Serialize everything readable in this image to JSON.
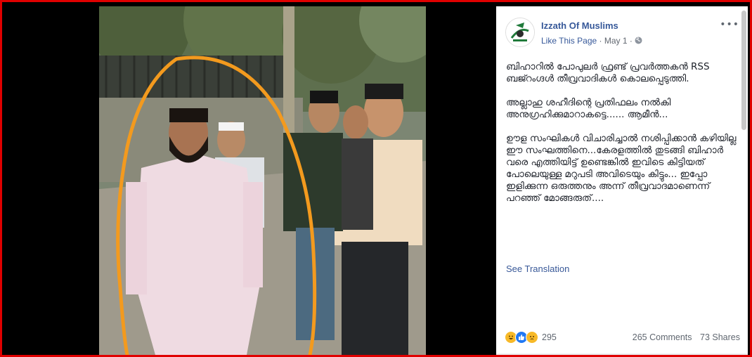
{
  "post": {
    "page_name": "Izzath Of Muslims",
    "like_label": "Like This Page",
    "separator": "·",
    "date": "May 1",
    "separator2": "·",
    "more": "•••",
    "paragraphs": [
      "ബിഹാറിൽ പോപുലർ ഫ്രണ്ട് പ്രവർത്തകൻ RSS ബജ്റംഗ്ദൾ തീവ്രവാദികൾ കൊലപ്പെടുത്തി.",
      "അല്ലാഹു ശഹീദിന്റെ പ്രതിഫലം നൽകി അനുഗ്രഹിക്കുമാറാകട്ടെ...... ആമീൻ...",
      "ഊള സംഘികൾ വിചാരിച്ചാൽ നശിപ്പിക്കാൻ കഴിയില്ല ഈ സംഘത്തിനെ...കേരളത്തിൽ തുടങ്ങി ബിഹാർ വരെ എത്തിയിട്ട് ഉണ്ടെങ്കിൽ ഇവിടെ കിട്ടിയത് പോലെയുള്ള മറുപടി അവിടെയും കിട്ടും... ഇപ്പോ ഇളിക്കുന്ന ഒരുത്തനും അന്ന് തീവ്രവാദമാണെന്ന് പറഞ്ഞ് മോങ്ങരുത്...."
    ],
    "see_translation": "See Translation",
    "reaction_count": "295",
    "comments": "265 Comments",
    "shares": "73 Shares",
    "colors": {
      "link": "#365899",
      "border": "#e00000",
      "haha": "#f7b928",
      "like": "#2078f4",
      "sad": "#f7b928"
    }
  }
}
